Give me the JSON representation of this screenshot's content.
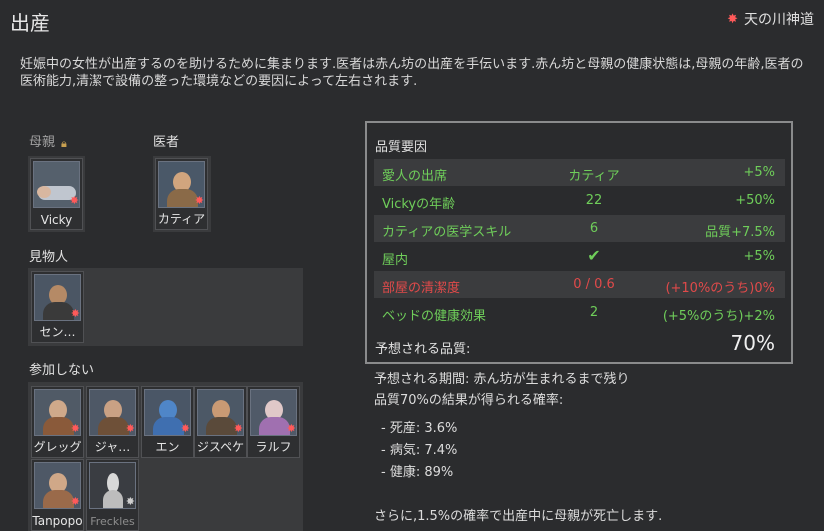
{
  "window": {
    "title": "出産",
    "ideology": "天の川神道"
  },
  "description": "妊娠中の女性が出産するのを助けるために集まります.医者は赤ん坊の出産を手伝います.赤ん坊と母親の健康状態は,母親の年齢,医者の医術能力,清潔で設備の整った環境などの要因によって左右されます.",
  "roles": {
    "mother": {
      "label": "母親",
      "pawn": "Vicky"
    },
    "doctor": {
      "label": "医者",
      "pawn": "カティア"
    },
    "spectators": {
      "label": "見物人",
      "pawns": [
        "セン…"
      ]
    },
    "not_participating": {
      "label": "参加しない",
      "pawns": [
        "グレッグ",
        "ジャ…",
        "エン",
        "ジスペケ",
        "ラルフ",
        "Tanpopo",
        "Freckles"
      ]
    }
  },
  "quality": {
    "title": "品質要因",
    "rows": [
      {
        "name": "愛人の出席",
        "value": "カティア",
        "effect": "+5%",
        "status": "good"
      },
      {
        "name": "Vickyの年齢",
        "value": "22",
        "effect": "+50%",
        "status": "good"
      },
      {
        "name": "カティアの医学スキル",
        "value": "6",
        "effect": "品質+7.5%",
        "status": "good"
      },
      {
        "name": "屋内",
        "value": "✔",
        "effect": "+5%",
        "status": "good"
      },
      {
        "name": "部屋の清潔度",
        "value": "0 / 0.6",
        "effect": "(+10%のうち)0%",
        "status": "bad"
      },
      {
        "name": "ベッドの健康効果",
        "value": "2",
        "effect": "(+5%のうち)+2%",
        "status": "good"
      }
    ],
    "expected_label": "予想される品質:",
    "expected_value": "70%"
  },
  "info": {
    "period": "予想される期間: 赤ん坊が生まれるまで残り",
    "chance_header": "品質70%の結果が得られる確率:",
    "outcomes": [
      "- 死産: 3.6%",
      "- 病気: 7.4%",
      "- 健康: 89%"
    ],
    "death_note": "さらに,1.5%の確率で出産中に母親が死亡します."
  },
  "colors": {
    "good": "#6fce5a",
    "bad": "#e04a4a",
    "accent": "#ff5a5a"
  }
}
